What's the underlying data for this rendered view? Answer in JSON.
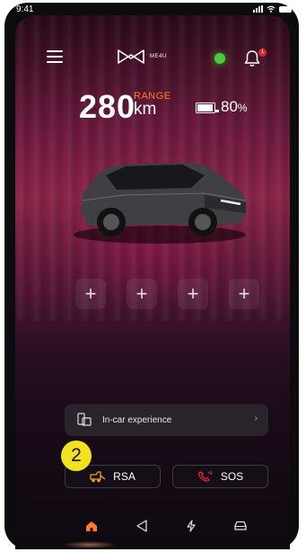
{
  "status_bar": {
    "time": "9:41"
  },
  "header": {
    "brand": "ME4U",
    "notification_count": "1",
    "connection_color": "#4ec93a"
  },
  "vehicle": {
    "range_value": "280",
    "range_label": "RANGE",
    "range_unit": "km",
    "battery_percent": "80",
    "battery_unit": "%"
  },
  "quick_actions": [
    {
      "label": "+"
    },
    {
      "label": "+"
    },
    {
      "label": "+"
    },
    {
      "label": "+"
    }
  ],
  "incar": {
    "label": "In-car experience",
    "chevron": "›"
  },
  "assist": {
    "rsa_label": "RSA",
    "sos_label": "SOS"
  },
  "annotation": {
    "marker": "2"
  },
  "nav": {
    "items": [
      "home-icon",
      "navigate-icon",
      "charging-icon",
      "car-icon"
    ],
    "active": "home-icon"
  },
  "colors": {
    "accent": "#ff7a2b",
    "sos_red": "#e0262e",
    "status_green": "#4ec93a"
  }
}
